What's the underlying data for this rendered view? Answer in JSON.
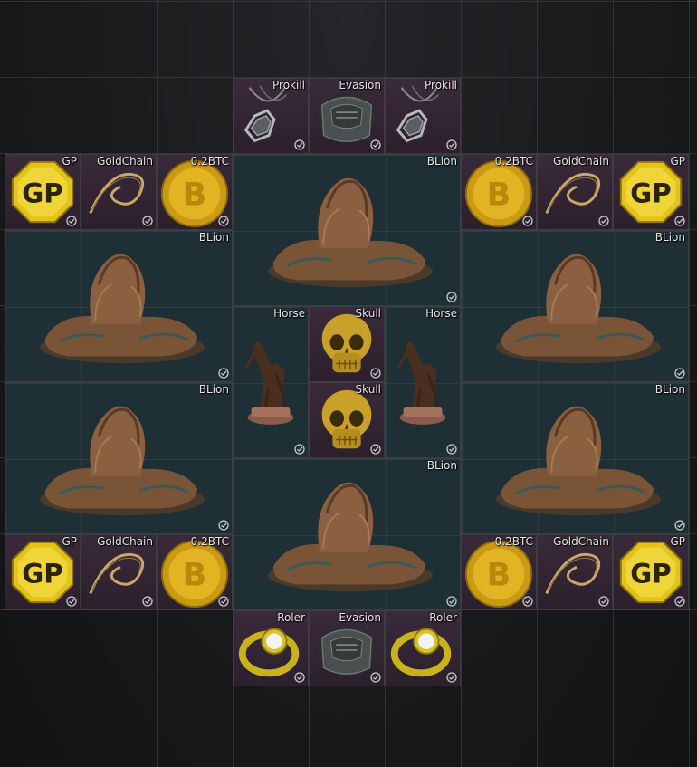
{
  "labels": {
    "prokill": "Prokill",
    "evasion": "Evasion",
    "gp": "GP",
    "goldchain": "GoldChain",
    "btc": "0.2BTC",
    "blion": "BLion",
    "horse": "Horse",
    "skull": "Skull",
    "roler": "Roler"
  },
  "colors": {
    "rare_bg": "#3a2a3a",
    "common_bg": "#1f2f36",
    "label_text": "#e4e4e4"
  }
}
